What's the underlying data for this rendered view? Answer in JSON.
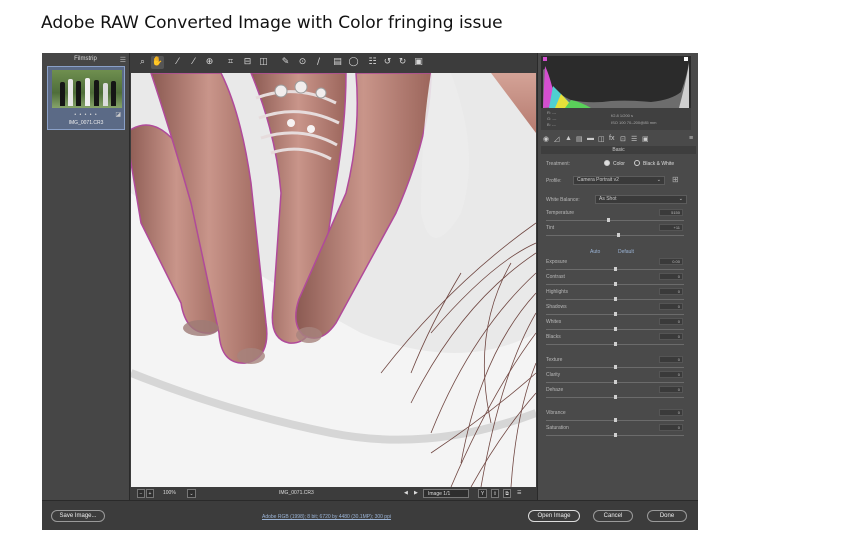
{
  "doc_title": "Adobe RAW Converted Image with Color fringing issue",
  "filmstrip": {
    "title": "Filmstrip",
    "thumb_stars": "• • • • •",
    "thumb_name": "IMG_0071.CR3"
  },
  "toolbar": {
    "tools": [
      "zoom-icon",
      "hand-icon",
      "white-balance-icon",
      "color-sampler-icon",
      "target-adjust-icon",
      "crop-icon",
      "straighten-icon",
      "transform-icon",
      "spot-removal-icon",
      "red-eye-icon",
      "brush-icon",
      "graduated-filter-icon",
      "radial-filter-icon",
      "presets-icon",
      "rotate-left-icon",
      "rotate-right-icon",
      "delete-icon"
    ],
    "export_icon": "export-icon"
  },
  "canvas": {
    "colors": {
      "skin": "#c38a80",
      "skin_shadow": "#8b5a52",
      "fabric": "#ececec",
      "hair": "#5a2a24",
      "fringe": "#b04a9a"
    }
  },
  "bottombar": {
    "zoom": "100%",
    "filename": "IMG_0071.CR3",
    "image_counter": "Image 1/1"
  },
  "histogram": {
    "row1_left": "R: ---",
    "row2_left": "G: ---",
    "row3_left": "B: ---",
    "row1_right": "f/2.8   1/200 s",
    "row2_right": "ISO 100   70–200@85 mm"
  },
  "panel": {
    "section_title": "Basic",
    "treatment_label": "Treatment:",
    "treatment_color": "Color",
    "treatment_bw": "Black & White",
    "profile_label": "Profile:",
    "profile_value": "Camera Portrait v2",
    "wb_label": "White Balance:",
    "wb_value": "As Shot",
    "auto_label": "Auto",
    "default_label": "Default",
    "sliders": [
      {
        "label": "Temperature",
        "value": "5150",
        "fraction": 0.45
      },
      {
        "label": "Tint",
        "value": "+11",
        "fraction": 0.52
      },
      {
        "label": "Exposure",
        "value": "0.00",
        "fraction": 0.5
      },
      {
        "label": "Contrast",
        "value": "0",
        "fraction": 0.5
      },
      {
        "label": "Highlights",
        "value": "0",
        "fraction": 0.5
      },
      {
        "label": "Shadows",
        "value": "0",
        "fraction": 0.5
      },
      {
        "label": "Whites",
        "value": "0",
        "fraction": 0.5
      },
      {
        "label": "Blacks",
        "value": "0",
        "fraction": 0.5
      },
      {
        "label": "Texture",
        "value": "0",
        "fraction": 0.5
      },
      {
        "label": "Clarity",
        "value": "0",
        "fraction": 0.5
      },
      {
        "label": "Dehaze",
        "value": "0",
        "fraction": 0.5
      },
      {
        "label": "Vibrance",
        "value": "0",
        "fraction": 0.5
      },
      {
        "label": "Saturation",
        "value": "0",
        "fraction": 0.5
      }
    ]
  },
  "footer": {
    "save_label": "Save Image...",
    "info_link": "Adobe RGB (1998); 8 bit; 6720 by 4480 (30.1MP); 300 ppi",
    "open_label": "Open Image",
    "cancel_label": "Cancel",
    "done_label": "Done"
  }
}
